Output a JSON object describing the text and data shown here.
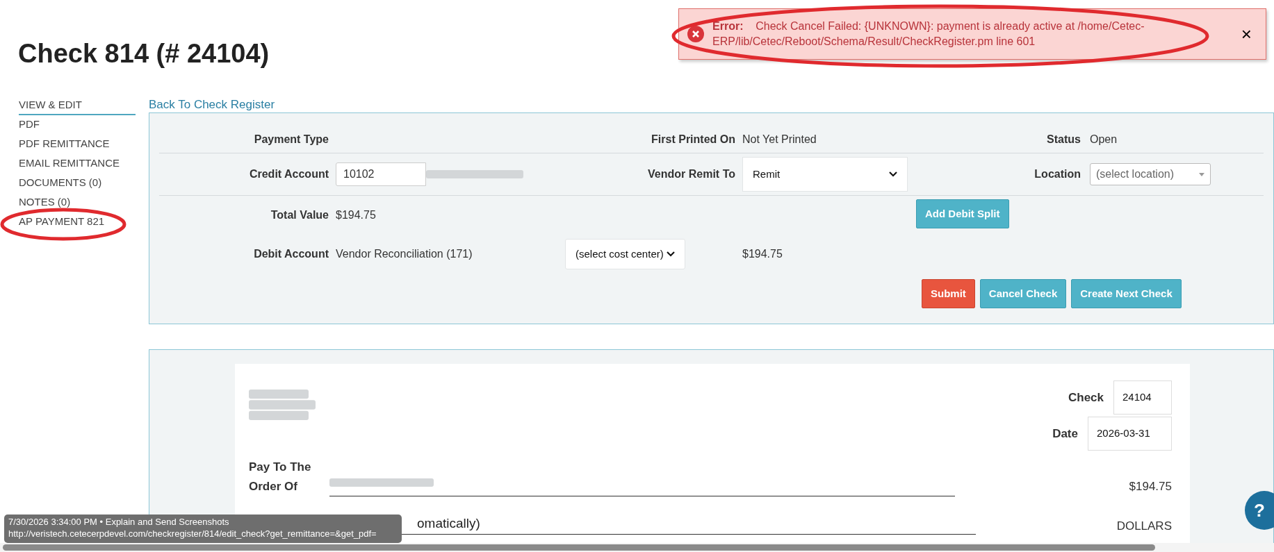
{
  "error": {
    "label": "Error:",
    "message": "Check Cancel Failed: {UNKNOWN}: payment is already active at /home/Cetec-ERP/lib/Cetec/Reboot/Schema/Result/CheckRegister.pm line 601",
    "close": "×"
  },
  "title": "Check 814 (# 24104)",
  "sidebar": {
    "items": [
      {
        "label": "VIEW & EDIT",
        "selected": true
      },
      {
        "label": "PDF",
        "selected": false
      },
      {
        "label": "PDF REMITTANCE",
        "selected": false
      },
      {
        "label": "EMAIL REMITTANCE",
        "selected": false
      },
      {
        "label": "DOCUMENTS (0)",
        "selected": false
      },
      {
        "label": "NOTES (0)",
        "selected": false
      },
      {
        "label": "AP PAYMENT 821",
        "selected": false
      }
    ]
  },
  "back_link": "Back To Check Register",
  "form": {
    "payment_type_label": "Payment Type",
    "first_printed_label": "First Printed On",
    "first_printed_value": "Not Yet Printed",
    "status_label": "Status",
    "status_value": "Open",
    "credit_account_label": "Credit Account",
    "credit_account_value": "10102",
    "vendor_remit_label": "Vendor Remit To",
    "vendor_remit_value": "Remit",
    "location_label": "Location",
    "location_placeholder": "(select location)",
    "total_value_label": "Total Value",
    "total_value": "$194.75",
    "add_debit_split": "Add Debit Split",
    "debit_account_label": "Debit Account",
    "debit_account_value": "Vendor Reconciliation (171)",
    "cost_center_value": "(select cost center)",
    "debit_amount": "$194.75",
    "buttons": [
      {
        "label": "Submit",
        "kind": "danger"
      },
      {
        "label": "Cancel Check",
        "kind": "info"
      },
      {
        "label": "Create Next Check",
        "kind": "info"
      }
    ]
  },
  "check": {
    "check_label": "Check",
    "check_number": "24104",
    "date_label": "Date",
    "date": "2026-03-31",
    "pay_to_label": "Pay To The Order Of",
    "amount": "$194.75",
    "text_amount": "omatically)",
    "dollars": "DOLLARS"
  },
  "help_button": "?",
  "tooltip": {
    "line_1": "7/30/2026 3:34:00 PM • Explain and Send Screenshots",
    "line_2": "http://veristech.cetecerpdevel.com/checkregister/814/edit_check?get_remittance=&get_pdf="
  }
}
